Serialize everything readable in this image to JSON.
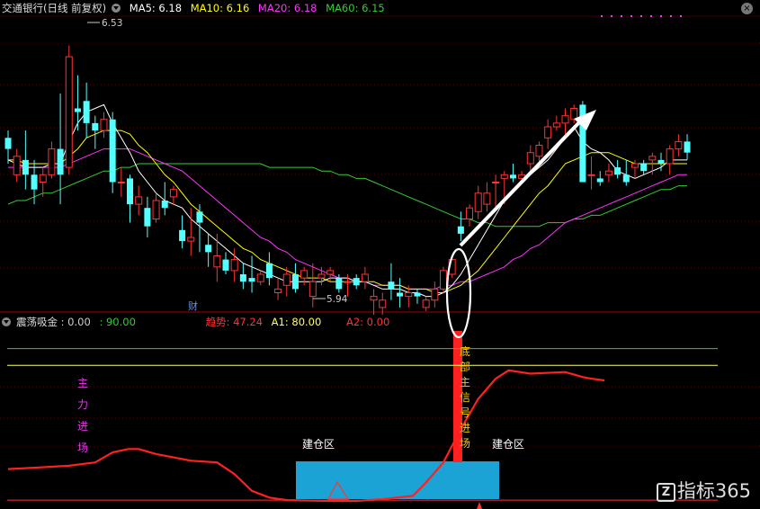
{
  "header": {
    "title": "交通银行(日线 前复权)",
    "ma": [
      {
        "label": "MA5: 6.18",
        "color": "#ffffff"
      },
      {
        "label": "MA10: 6.16",
        "color": "#ffff00"
      },
      {
        "label": "MA20: 6.18",
        "color": "#ff33ff"
      },
      {
        "label": "MA60: 6.15",
        "color": "#33cc33"
      }
    ]
  },
  "indicator_header": {
    "name": "震荡吸金",
    "values": [
      {
        "label": ": 0.00",
        "color": "#cccccc"
      },
      {
        "label": ": 90.00",
        "color": "#33cc33"
      },
      {
        "label": "趋势: 47.24",
        "color": "#ff3333"
      },
      {
        "label": "A1: 80.00",
        "color": "#ffff66"
      },
      {
        "label": "A2: 0.00",
        "color": "#ff3333"
      }
    ]
  },
  "annotations": {
    "high": "6.53",
    "low": "5.94",
    "finance": "财",
    "main_force": "主力进场",
    "bottom_signal": "底部主信号进场",
    "build_left": "建仓区",
    "build_right": "建仓区"
  },
  "watermark": "指标365",
  "watermark_icon": "Z",
  "colors": {
    "up": "#ff3333",
    "down": "#54ffff",
    "ma5": "#ffffff",
    "ma10": "#ffff00",
    "ma20": "#ff33ff",
    "ma60": "#33cc33",
    "trend": "#ff2020",
    "build_zone": "#1ba3d6"
  },
  "chart_data": [
    {
      "type": "candlestick",
      "title": "交通银行(日线 前复权)",
      "ylim": [
        5.81,
        6.61
      ],
      "series": [
        {
          "name": "K",
          "ohlc": [
            [
              6.28,
              6.3,
              6.21,
              6.25
            ],
            [
              6.18,
              6.25,
              6.16,
              6.23
            ],
            [
              6.22,
              6.3,
              6.14,
              6.18
            ],
            [
              6.18,
              6.22,
              6.1,
              6.14
            ],
            [
              6.16,
              6.2,
              6.12,
              6.18
            ],
            [
              6.18,
              6.27,
              6.17,
              6.25
            ],
            [
              6.25,
              6.4,
              6.1,
              6.18
            ],
            [
              6.2,
              6.53,
              6.18,
              6.5
            ],
            [
              6.36,
              6.45,
              6.3,
              6.35
            ],
            [
              6.38,
              6.43,
              6.28,
              6.32
            ],
            [
              6.32,
              6.34,
              6.25,
              6.3
            ],
            [
              6.3,
              6.35,
              6.28,
              6.33
            ],
            [
              6.33,
              6.35,
              6.13,
              6.16
            ],
            [
              6.16,
              6.2,
              6.12,
              6.16
            ],
            [
              6.17,
              6.18,
              6.05,
              6.1
            ],
            [
              6.1,
              6.15,
              6.07,
              6.12
            ],
            [
              6.09,
              6.12,
              6.01,
              6.04
            ],
            [
              6.06,
              6.13,
              6.05,
              6.11
            ],
            [
              6.11,
              6.16,
              6.07,
              6.09
            ],
            [
              6.12,
              6.15,
              6.1,
              6.14
            ],
            [
              6.03,
              6.07,
              5.98,
              6.0
            ],
            [
              6.0,
              6.09,
              5.96,
              6.01
            ],
            [
              6.08,
              6.1,
              5.97,
              6.05
            ],
            [
              5.99,
              6.02,
              5.93,
              5.97
            ],
            [
              5.93,
              6.02,
              5.89,
              5.96
            ],
            [
              5.95,
              5.97,
              5.91,
              5.92
            ],
            [
              5.92,
              5.98,
              5.89,
              5.95
            ],
            [
              5.91,
              5.94,
              5.87,
              5.89
            ],
            [
              5.9,
              5.96,
              5.86,
              5.89
            ],
            [
              5.89,
              5.92,
              5.88,
              5.91
            ],
            [
              5.94,
              5.97,
              5.88,
              5.9
            ],
            [
              5.86,
              5.9,
              5.84,
              5.87
            ],
            [
              5.88,
              5.93,
              5.85,
              5.91
            ],
            [
              5.91,
              5.94,
              5.86,
              5.87
            ],
            [
              5.9,
              5.93,
              5.88,
              5.92
            ],
            [
              5.85,
              5.94,
              5.82,
              5.89
            ],
            [
              5.9,
              5.93,
              5.88,
              5.91
            ],
            [
              5.91,
              5.93,
              5.89,
              5.92
            ],
            [
              5.9,
              5.91,
              5.86,
              5.87
            ],
            [
              5.89,
              5.91,
              5.85,
              5.89
            ],
            [
              5.9,
              5.91,
              5.87,
              5.88
            ],
            [
              5.89,
              5.93,
              5.87,
              5.91
            ],
            [
              5.84,
              5.87,
              5.8,
              5.85
            ],
            [
              5.82,
              5.86,
              5.8,
              5.84
            ],
            [
              5.89,
              5.94,
              5.84,
              5.87
            ],
            [
              5.86,
              5.9,
              5.82,
              5.85
            ],
            [
              5.85,
              5.88,
              5.82,
              5.86
            ],
            [
              5.86,
              5.87,
              5.83,
              5.85
            ],
            [
              5.82,
              5.85,
              5.81,
              5.84
            ],
            [
              5.84,
              5.89,
              5.82,
              5.87
            ],
            [
              5.87,
              5.93,
              5.86,
              5.92
            ],
            [
              5.91,
              5.96,
              5.9,
              5.95
            ],
            [
              6.04,
              6.08,
              6.0,
              6.02
            ],
            [
              6.06,
              6.1,
              6.04,
              6.09
            ],
            [
              6.08,
              6.15,
              6.06,
              6.13
            ],
            [
              6.1,
              6.16,
              6.08,
              6.13
            ],
            [
              6.16,
              6.18,
              6.09,
              6.16
            ],
            [
              6.17,
              6.19,
              6.1,
              6.18
            ],
            [
              6.18,
              6.21,
              6.16,
              6.17
            ],
            [
              6.17,
              6.19,
              6.16,
              6.18
            ],
            [
              6.21,
              6.26,
              6.18,
              6.24
            ],
            [
              6.23,
              6.27,
              6.21,
              6.26
            ],
            [
              6.28,
              6.33,
              6.25,
              6.31
            ],
            [
              6.31,
              6.34,
              6.3,
              6.32
            ],
            [
              6.32,
              6.36,
              6.29,
              6.34
            ],
            [
              6.33,
              6.37,
              6.32,
              6.36
            ],
            [
              6.37,
              6.38,
              6.16,
              6.16
            ],
            [
              6.18,
              6.23,
              6.14,
              6.18
            ],
            [
              6.17,
              6.19,
              6.15,
              6.16
            ],
            [
              6.18,
              6.21,
              6.16,
              6.19
            ],
            [
              6.2,
              6.22,
              6.17,
              6.18
            ],
            [
              6.18,
              6.22,
              6.15,
              6.16
            ],
            [
              6.2,
              6.22,
              6.17,
              6.21
            ],
            [
              6.21,
              6.22,
              6.18,
              6.19
            ],
            [
              6.22,
              6.24,
              6.18,
              6.23
            ],
            [
              6.22,
              6.24,
              6.19,
              6.21
            ],
            [
              6.21,
              6.26,
              6.18,
              6.25
            ],
            [
              6.25,
              6.29,
              6.23,
              6.27
            ],
            [
              6.27,
              6.29,
              6.22,
              6.24
            ]
          ]
        },
        {
          "name": "MA5",
          "values": [
            6.22,
            6.21,
            6.2,
            6.2,
            6.2,
            6.21,
            6.21,
            6.27,
            6.32,
            6.35,
            6.36,
            6.37,
            6.32,
            6.28,
            6.24,
            6.19,
            6.16,
            6.13,
            6.11,
            6.1,
            6.09,
            6.06,
            6.04,
            6.02,
            6.0,
            5.98,
            5.96,
            5.94,
            5.93,
            5.92,
            5.91,
            5.9,
            5.89,
            5.89,
            5.89,
            5.89,
            5.89,
            5.9,
            5.9,
            5.9,
            5.89,
            5.89,
            5.88,
            5.87,
            5.87,
            5.87,
            5.86,
            5.86,
            5.85,
            5.85,
            5.86,
            5.88,
            5.91,
            5.95,
            5.99,
            6.03,
            6.07,
            6.11,
            6.14,
            6.16,
            6.18,
            6.2,
            6.22,
            6.25,
            6.28,
            6.31,
            6.27,
            6.25,
            6.24,
            6.22,
            6.19,
            6.18,
            6.17,
            6.18,
            6.19,
            6.2,
            6.22,
            6.22,
            6.22
          ]
        },
        {
          "name": "MA10",
          "values": [
            6.22,
            6.22,
            6.21,
            6.21,
            6.21,
            6.21,
            6.21,
            6.23,
            6.25,
            6.28,
            6.29,
            6.3,
            6.3,
            6.3,
            6.29,
            6.26,
            6.24,
            6.21,
            6.18,
            6.16,
            6.13,
            6.1,
            6.08,
            6.06,
            6.04,
            6.02,
            6.0,
            5.98,
            5.97,
            5.95,
            5.94,
            5.93,
            5.92,
            5.91,
            5.9,
            5.9,
            5.9,
            5.89,
            5.89,
            5.89,
            5.89,
            5.89,
            5.89,
            5.88,
            5.88,
            5.88,
            5.87,
            5.87,
            5.87,
            5.86,
            5.86,
            5.87,
            5.88,
            5.9,
            5.92,
            5.95,
            5.98,
            6.01,
            6.04,
            6.07,
            6.1,
            6.13,
            6.15,
            6.18,
            6.21,
            6.22,
            6.23,
            6.24,
            6.24,
            6.24,
            6.23,
            6.22,
            6.21,
            6.21,
            6.21,
            6.21,
            6.21,
            6.21,
            6.21
          ]
        },
        {
          "name": "MA20",
          "values": [
            6.2,
            6.2,
            6.2,
            6.2,
            6.2,
            6.2,
            6.2,
            6.21,
            6.22,
            6.23,
            6.24,
            6.25,
            6.25,
            6.25,
            6.25,
            6.24,
            6.23,
            6.22,
            6.21,
            6.2,
            6.19,
            6.17,
            6.15,
            6.13,
            6.11,
            6.09,
            6.07,
            6.05,
            6.03,
            6.01,
            6.0,
            5.98,
            5.97,
            5.95,
            5.94,
            5.93,
            5.92,
            5.91,
            5.9,
            5.9,
            5.89,
            5.89,
            5.88,
            5.88,
            5.88,
            5.88,
            5.87,
            5.87,
            5.87,
            5.87,
            5.88,
            5.88,
            5.89,
            5.89,
            5.9,
            5.91,
            5.92,
            5.93,
            5.95,
            5.96,
            5.98,
            5.99,
            6.01,
            6.03,
            6.05,
            6.06,
            6.07,
            6.08,
            6.09,
            6.1,
            6.11,
            6.12,
            6.13,
            6.14,
            6.15,
            6.16,
            6.17,
            6.18,
            6.18
          ]
        },
        {
          "name": "MA60",
          "values": [
            6.1,
            6.11,
            6.11,
            6.12,
            6.13,
            6.13,
            6.14,
            6.15,
            6.16,
            6.17,
            6.18,
            6.19,
            6.19,
            6.2,
            6.2,
            6.21,
            6.21,
            6.21,
            6.21,
            6.21,
            6.21,
            6.21,
            6.21,
            6.21,
            6.21,
            6.21,
            6.21,
            6.21,
            6.21,
            6.21,
            6.2,
            6.2,
            6.2,
            6.2,
            6.2,
            6.2,
            6.19,
            6.19,
            6.18,
            6.18,
            6.17,
            6.17,
            6.16,
            6.15,
            6.14,
            6.13,
            6.12,
            6.11,
            6.1,
            6.09,
            6.08,
            6.07,
            6.06,
            6.06,
            6.05,
            6.05,
            6.04,
            6.04,
            6.04,
            6.04,
            6.04,
            6.04,
            6.05,
            6.05,
            6.05,
            6.06,
            6.06,
            6.07,
            6.07,
            6.08,
            6.09,
            6.1,
            6.11,
            6.12,
            6.13,
            6.14,
            6.14,
            6.15,
            6.15
          ]
        }
      ]
    },
    {
      "type": "line",
      "title": "震荡吸金",
      "ylim": [
        -1,
        100
      ],
      "series": [
        {
          "name": "趋势",
          "values": [
            [
              0,
              18
            ],
            [
              3.5,
              19
            ],
            [
              7,
              20
            ],
            [
              10,
              22
            ],
            [
              12,
              28
            ],
            [
              13.8,
              30
            ],
            [
              15,
              30
            ],
            [
              17,
              27
            ],
            [
              19,
              25
            ],
            [
              21,
              23
            ],
            [
              24,
              22
            ],
            [
              26,
              15
            ],
            [
              28,
              5
            ],
            [
              30,
              1
            ],
            [
              32,
              -0.5
            ],
            [
              37,
              -1
            ],
            [
              40,
              -1
            ],
            [
              43,
              0
            ],
            [
              46.5,
              2
            ],
            [
              48,
              10
            ],
            [
              50,
              22
            ],
            [
              52,
              42
            ],
            [
              54,
              60
            ],
            [
              56,
              72
            ],
            [
              57.5,
              77
            ],
            [
              60,
              75
            ],
            [
              64,
              76
            ],
            [
              66,
              73
            ],
            [
              67,
              72
            ],
            [
              68.5,
              71
            ]
          ]
        },
        {
          "name": "A1",
          "values": [
            80,
            80
          ]
        },
        {
          "name": "A2",
          "values": [
            0,
            0
          ]
        }
      ]
    }
  ]
}
